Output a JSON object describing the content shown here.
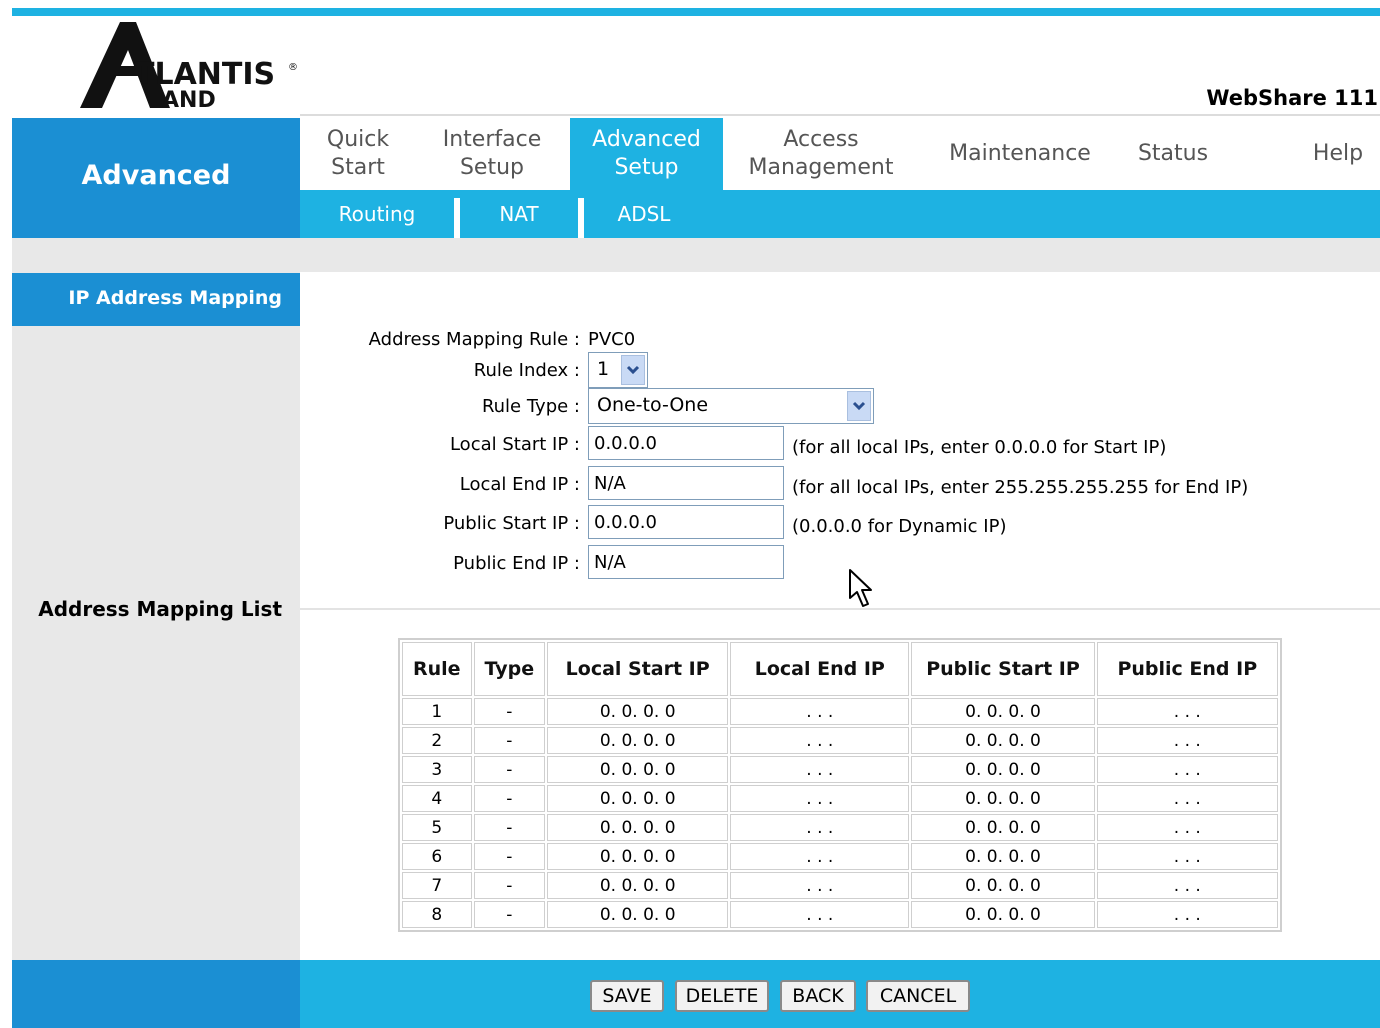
{
  "brand": {
    "logo_text": "ATLANTIS LAND",
    "model": "WebShare 111"
  },
  "section_title": "Advanced",
  "nav": {
    "tabs": [
      {
        "l1": "Quick",
        "l2": "Start"
      },
      {
        "l1": "Interface",
        "l2": "Setup"
      },
      {
        "l1": "Advanced",
        "l2": "Setup"
      },
      {
        "l1": "Access",
        "l2": "Management"
      },
      {
        "l1": "Maintenance",
        "l2": ""
      },
      {
        "l1": "Status",
        "l2": ""
      },
      {
        "l1": "Help",
        "l2": ""
      }
    ],
    "active_tab": "Advanced Setup",
    "subtabs": [
      "Routing",
      "NAT",
      "ADSL"
    ]
  },
  "sidebar": {
    "item": "IP Address Mapping",
    "list_label": "Address Mapping List"
  },
  "form": {
    "mapping_rule_label": "Address Mapping Rule :",
    "mapping_rule_value": "PVC0",
    "rule_index_label": "Rule Index :",
    "rule_index_value": "1",
    "rule_type_label": "Rule Type :",
    "rule_type_value": "One-to-One",
    "local_start_label": "Local Start IP :",
    "local_start_value": "0.0.0.0",
    "local_start_hint": "(for all local IPs, enter 0.0.0.0 for Start IP)",
    "local_end_label": "Local End IP :",
    "local_end_value": "N/A",
    "local_end_hint": "(for all local IPs, enter 255.255.255.255 for End IP)",
    "public_start_label": "Public Start IP :",
    "public_start_value": "0.0.0.0",
    "public_start_hint": "(0.0.0.0 for Dynamic IP)",
    "public_end_label": "Public End IP :",
    "public_end_value": "N/A"
  },
  "table": {
    "headers": [
      "Rule",
      "Type",
      "Local Start IP",
      "Local End IP",
      "Public Start IP",
      "Public End IP"
    ],
    "rows": [
      [
        "1",
        "-",
        "0. 0. 0. 0",
        ". . .",
        "0. 0. 0. 0",
        ". . ."
      ],
      [
        "2",
        "-",
        "0. 0. 0. 0",
        ". . .",
        "0. 0. 0. 0",
        ". . ."
      ],
      [
        "3",
        "-",
        "0. 0. 0. 0",
        ". . .",
        "0. 0. 0. 0",
        ". . ."
      ],
      [
        "4",
        "-",
        "0. 0. 0. 0",
        ". . .",
        "0. 0. 0. 0",
        ". . ."
      ],
      [
        "5",
        "-",
        "0. 0. 0. 0",
        ". . .",
        "0. 0. 0. 0",
        ". . ."
      ],
      [
        "6",
        "-",
        "0. 0. 0. 0",
        ". . .",
        "0. 0. 0. 0",
        ". . ."
      ],
      [
        "7",
        "-",
        "0. 0. 0. 0",
        ". . .",
        "0. 0. 0. 0",
        ". . ."
      ],
      [
        "8",
        "-",
        "0. 0. 0. 0",
        ". . .",
        "0. 0. 0. 0",
        ". . ."
      ]
    ]
  },
  "buttons": {
    "save": "SAVE",
    "delete": "DELETE",
    "back": "BACK",
    "cancel": "CANCEL"
  },
  "icons": {
    "dropdown": "chevron-down-icon",
    "cursor": "mouse-pointer-icon"
  },
  "colors": {
    "accent": "#1eb2e2",
    "accent_dark": "#1b8fd3",
    "panel_gray": "#e8e8e8"
  }
}
